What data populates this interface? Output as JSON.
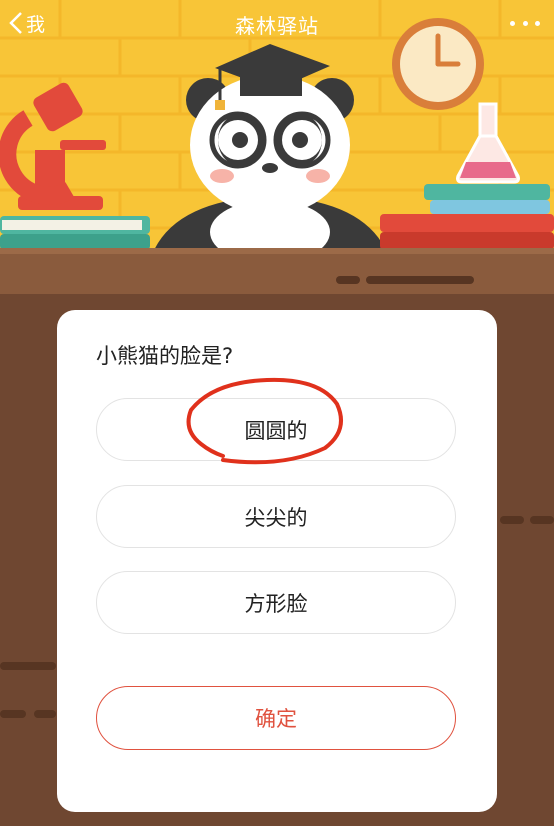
{
  "header": {
    "back_label": "我",
    "title": "森林驿站"
  },
  "quiz": {
    "question": "小熊猫的脸是?",
    "options": [
      "圆圆的",
      "尖尖的",
      "方形脸"
    ],
    "confirm_label": "确定"
  },
  "colors": {
    "header_bg": "#f8c537",
    "wood": "#6f4731",
    "accent": "#e0523f",
    "annotation_mark": "#e0311c"
  },
  "icons": [
    "back-chevron-icon",
    "more-dots-icon",
    "panda-graduate",
    "microscope-icon",
    "clock-icon",
    "flask-icon",
    "books-icon"
  ]
}
